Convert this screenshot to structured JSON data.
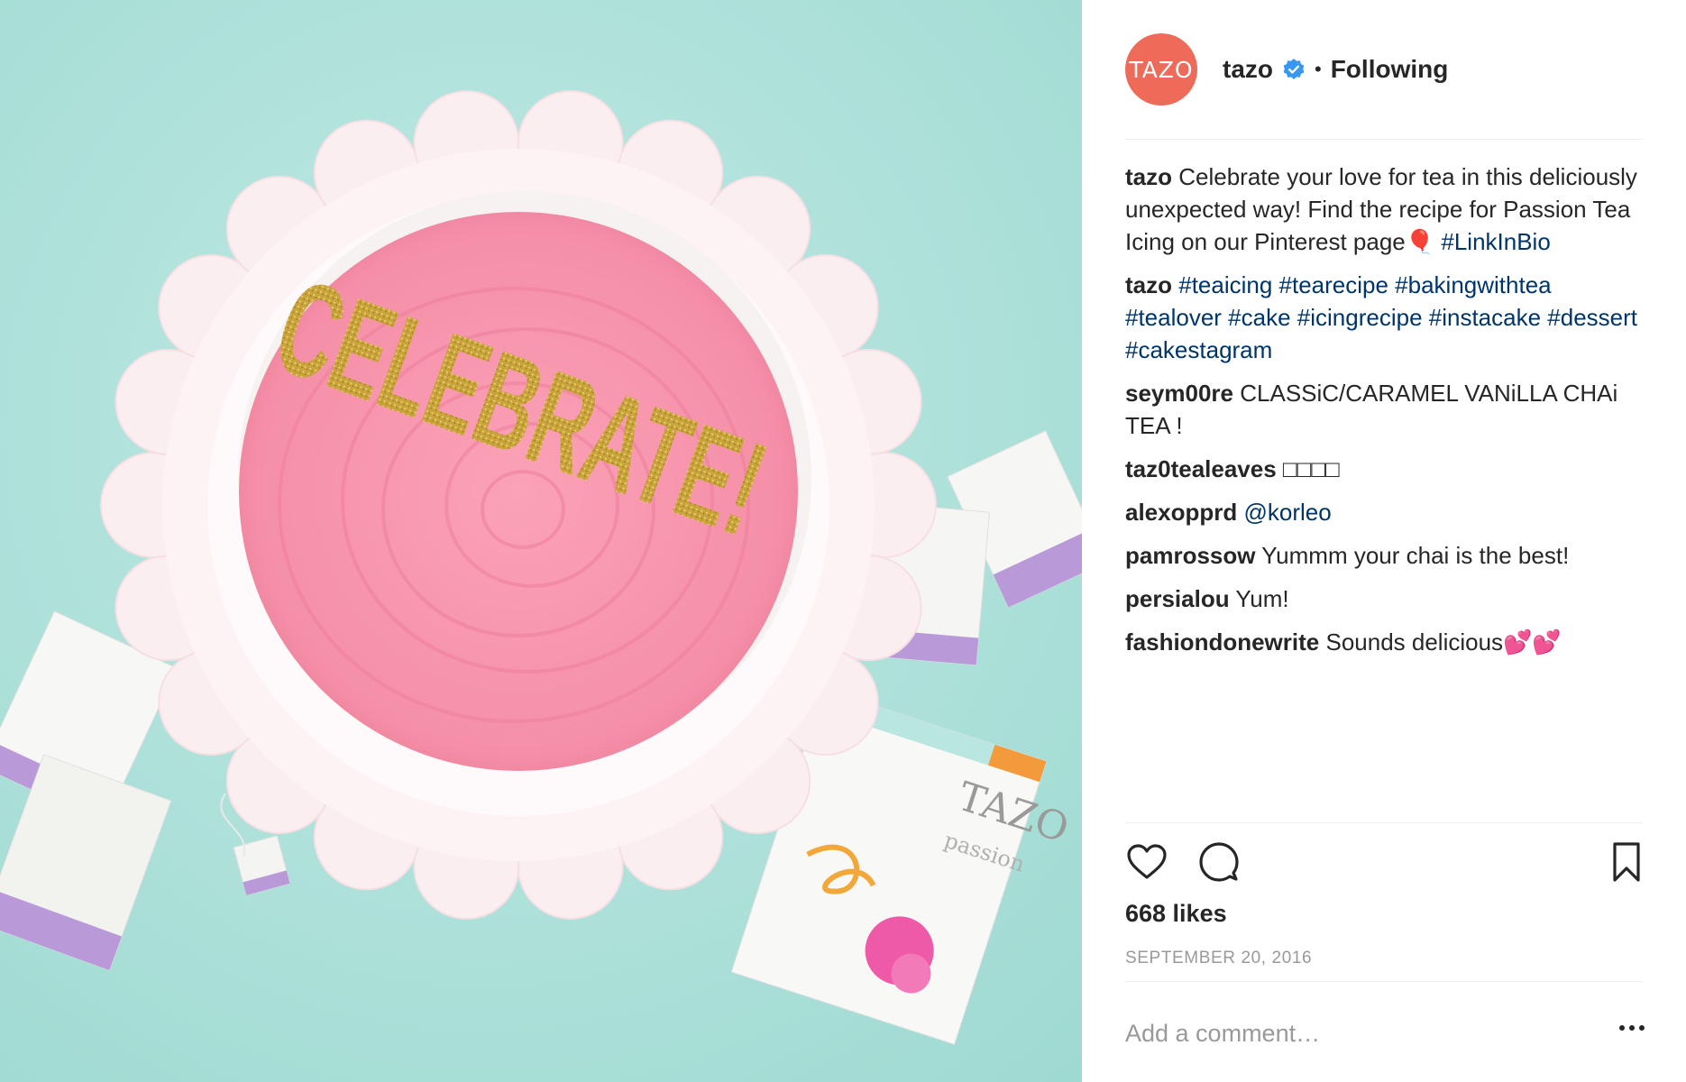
{
  "post": {
    "photo_text": "CELEBRATE!",
    "box_brand": "TAZO",
    "box_flavor": "passion"
  },
  "header": {
    "avatar_text": "TAZO",
    "username": "tazo",
    "verified_icon": "verified-badge-icon",
    "dot": "•",
    "follow_status": "Following"
  },
  "comments": [
    {
      "user": "tazo",
      "text": "Celebrate your love for tea in this deliciously unexpected way! Find the recipe for Passion Tea Icing on our Pinterest page🎈",
      "tags": "#LinkInBio"
    },
    {
      "user": "tazo",
      "text": "",
      "tags": "#teaicing #tearecipe #bakingwithtea #tealover #cake #icingrecipe #instacake #dessert #cakestagram"
    },
    {
      "user": "seym00re",
      "text": "CLASSiC/CARAMEL VANiLLA CHAi TEA !",
      "tags": ""
    },
    {
      "user": "taz0tealeaves",
      "text": "□□□□",
      "tags": ""
    },
    {
      "user": "alexopprd",
      "text": "",
      "tags": "@korleo"
    },
    {
      "user": "pamrossow",
      "text": "Yummm your chai is the best!",
      "tags": ""
    },
    {
      "user": "persialou",
      "text": "Yum!",
      "tags": ""
    },
    {
      "user": "fashiondonewrite",
      "text": "Sounds delicious💕💕",
      "tags": ""
    }
  ],
  "actions": {
    "like_icon": "heart-icon",
    "comment_icon": "comment-icon",
    "save_icon": "bookmark-icon"
  },
  "likes": "668 likes",
  "date": "SEPTEMBER 20, 2016",
  "comment_box": {
    "placeholder": "Add a comment…"
  },
  "more_icon": "more-options-icon",
  "colors": {
    "background_teal": "#aee2db",
    "icing_pink": "#f58fa8",
    "gold": "#c9a43a",
    "avatar": "#ee6b5a",
    "link": "#003569"
  }
}
